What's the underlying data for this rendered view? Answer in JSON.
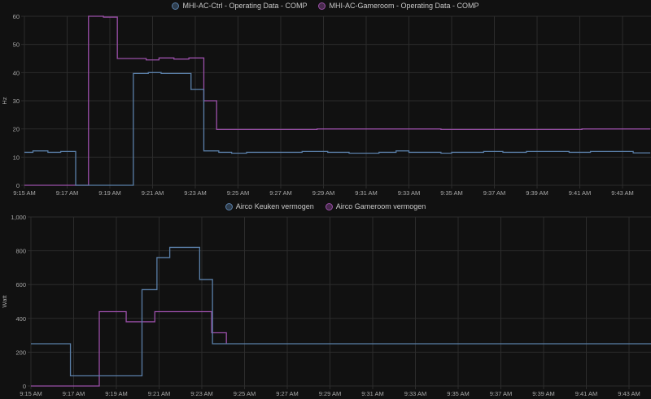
{
  "chart_data": [
    {
      "type": "line",
      "step": true,
      "ylabel": "Hz",
      "xlabel": "",
      "ylim": [
        0,
        60
      ],
      "yticks": [
        0,
        10,
        20,
        30,
        40,
        50,
        60
      ],
      "xlim_minutes": [
        0,
        29.3
      ],
      "xtick_labels": [
        "9:15 AM",
        "9:17 AM",
        "9:19 AM",
        "9:21 AM",
        "9:23 AM",
        "9:25 AM",
        "9:27 AM",
        "9:29 AM",
        "9:31 AM",
        "9:33 AM",
        "9:35 AM",
        "9:37 AM",
        "9:39 AM",
        "9:41 AM",
        "9:43 AM"
      ],
      "legend_position": "top-center",
      "series": [
        {
          "name": "MHI-AC-Ctrl - Operating Data - COMP",
          "color": "#5a7fa8",
          "x": [
            0,
            0.4,
            1.1,
            1.7,
            2.4,
            5.1,
            5.8,
            6.4,
            7.8,
            8.4,
            9.1,
            9.7,
            10.4,
            13.0,
            14.2,
            15.2,
            16.6,
            17.4,
            18.0,
            19.5,
            20.0,
            21.5,
            22.4,
            23.5,
            25.5,
            26.5,
            28.5,
            29.3
          ],
          "y": [
            11.7,
            12.2,
            11.7,
            12,
            0,
            39.7,
            40,
            39.7,
            34,
            12.2,
            11.7,
            11.4,
            11.7,
            12,
            11.7,
            11.4,
            11.7,
            12.2,
            11.7,
            11.4,
            11.7,
            12,
            11.7,
            12,
            11.7,
            12,
            11.5,
            11.5
          ]
        },
        {
          "name": "MHI-AC-Gameroom - Operating Data - COMP",
          "color": "#9a4fa8",
          "x": [
            0,
            3.0,
            3.7,
            4.35,
            5.7,
            6.3,
            7.0,
            7.7,
            8.4,
            9.0,
            13.7,
            19.5,
            26.1,
            29.3
          ],
          "y": [
            0,
            60,
            59.7,
            45,
            44.5,
            45.2,
            44.8,
            45.2,
            30,
            19.8,
            20,
            19.8,
            20,
            20
          ]
        }
      ]
    },
    {
      "type": "line",
      "step": true,
      "ylabel": "Watt",
      "xlabel": "",
      "ylim": [
        0,
        1000
      ],
      "yticks": [
        0,
        200,
        400,
        600,
        800,
        1000
      ],
      "ytick_labels": [
        "0",
        "200",
        "400",
        "600",
        "800",
        "1,000"
      ],
      "xlim_minutes": [
        0,
        29.3
      ],
      "xtick_labels": [
        "9:15 AM",
        "9:17 AM",
        "9:19 AM",
        "9:21 AM",
        "9:23 AM",
        "9:25 AM",
        "9:27 AM",
        "9:29 AM",
        "9:31 AM",
        "9:33 AM",
        "9:35 AM",
        "9:37 AM",
        "9:39 AM",
        "9:41 AM",
        "9:43 AM"
      ],
      "legend_position": "top-center",
      "series": [
        {
          "name": "Airco Keuken vermogen",
          "color": "#5a7fa8",
          "x": [
            0,
            1.85,
            5.2,
            5.9,
            6.5,
            7.9,
            8.5,
            29.3
          ],
          "y": [
            250,
            60,
            570,
            760,
            820,
            630,
            250,
            250
          ]
        },
        {
          "name": "Airco Gameroom vermogen",
          "color": "#9a4fa8",
          "x": [
            0,
            3.2,
            4.46,
            5.8,
            8.46,
            9.15
          ],
          "y": [
            0,
            440,
            380,
            440,
            315,
            250
          ]
        }
      ]
    }
  ]
}
